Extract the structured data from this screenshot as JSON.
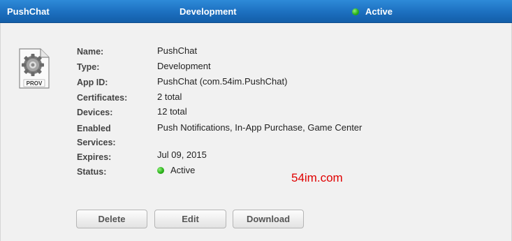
{
  "header": {
    "name": "PushChat",
    "type": "Development",
    "status": "Active",
    "status_color": "#2bb21a",
    "bar_color": "#1c6fbf"
  },
  "icon": {
    "name": "provisioning-profile-file-icon",
    "caption": "PROV"
  },
  "details": {
    "name_label": "Name:",
    "name_value": "PushChat",
    "type_label": "Type:",
    "type_value": "Development",
    "appid_label": "App ID:",
    "appid_value": "PushChat (com.54im.PushChat)",
    "certificates_label": "Certificates:",
    "certificates_value": "2 total",
    "devices_label": "Devices:",
    "devices_value": "12 total",
    "services_label_1": "Enabled",
    "services_label_2": "Services:",
    "services_value": "Push Notifications, In-App Purchase, Game Center",
    "expires_label": "Expires:",
    "expires_value": "Jul 09, 2015",
    "status_label": "Status:",
    "status_value": "Active"
  },
  "watermark": "54im.com",
  "buttons": {
    "delete": "Delete",
    "edit": "Edit",
    "download": "Download"
  }
}
